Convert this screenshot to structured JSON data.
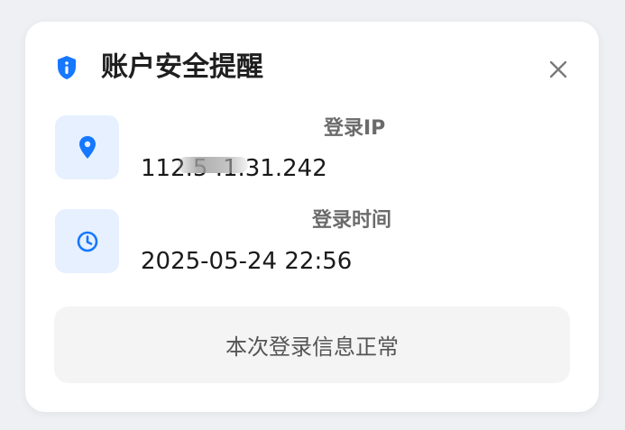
{
  "dialog": {
    "title": "账户安全提醒",
    "header_icon": "shield-info-icon",
    "close_icon": "close-icon"
  },
  "rows": [
    {
      "icon": "location-pin-icon",
      "label": "登录IP",
      "value": "112.5 .1.31.242"
    },
    {
      "icon": "clock-icon",
      "label": "登录时间",
      "value": "2025-05-24 22:56"
    }
  ],
  "status": {
    "text": "本次登录信息正常"
  },
  "colors": {
    "accent": "#1677ff",
    "icon_box_bg": "#e6f0fe",
    "status_bg": "#f4f4f4"
  }
}
